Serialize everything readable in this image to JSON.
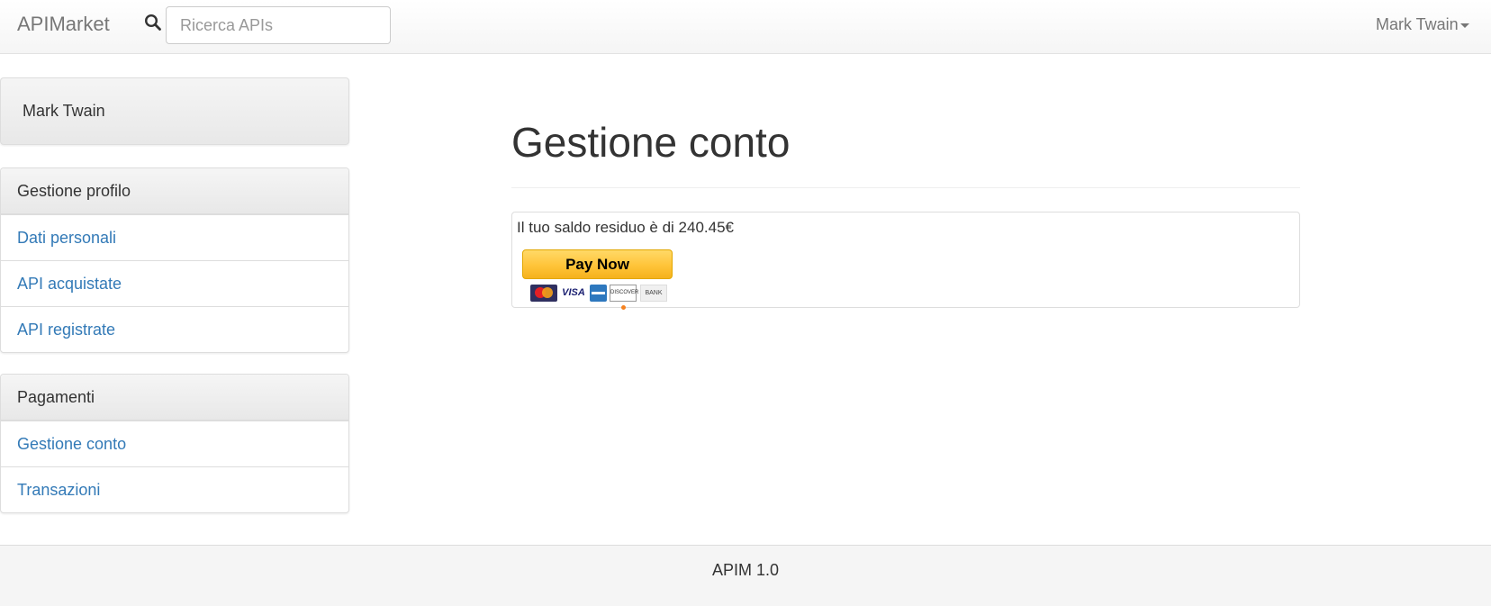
{
  "navbar": {
    "brand": "APIMarket",
    "search_icon": "search-icon",
    "search_placeholder": "Ricerca APIs",
    "user_menu_label": "Mark Twain"
  },
  "sidebar": {
    "user_name": "Mark Twain",
    "profile_section": {
      "heading": "Gestione profilo",
      "items": [
        {
          "label": "Dati personali"
        },
        {
          "label": "API acquistate"
        },
        {
          "label": "API registrate"
        }
      ]
    },
    "payments_section": {
      "heading": "Pagamenti",
      "items": [
        {
          "label": "Gestione conto"
        },
        {
          "label": "Transazioni"
        }
      ]
    }
  },
  "main": {
    "title": "Gestione conto",
    "balance_text": "Il tuo saldo residuo è di 240.45€",
    "pay_button_label": "Pay Now",
    "payment_methods": [
      "mastercard-icon",
      "visa-icon",
      "amex-icon",
      "discover-icon",
      "bank-icon"
    ],
    "payment_method_labels": {
      "visa": "VISA",
      "discover": "DISCOVER",
      "bank": "BANK"
    }
  },
  "footer": {
    "text": "APIM 1.0"
  },
  "colors": {
    "link": "#337ab7",
    "pay_button": "#ffc439"
  }
}
